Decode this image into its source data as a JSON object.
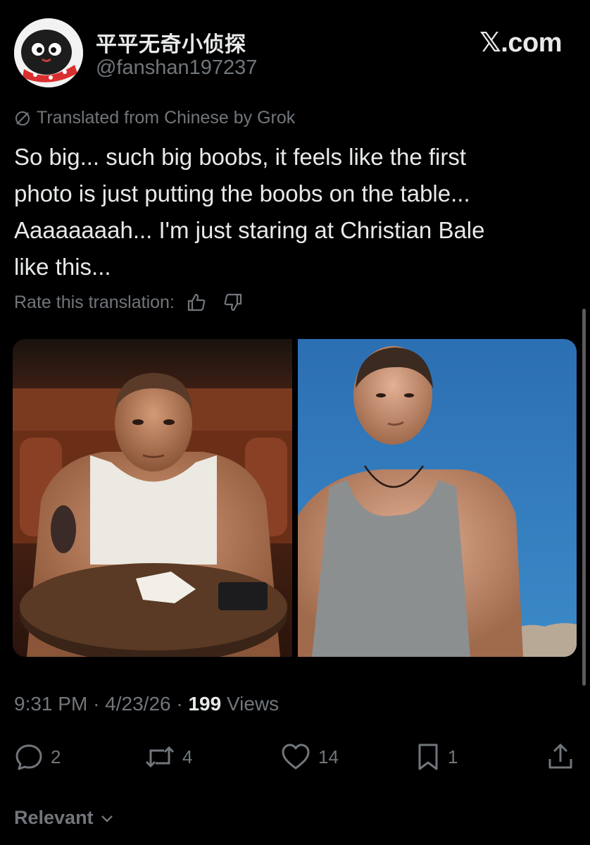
{
  "user": {
    "display_name": "平平无奇小侦探",
    "handle": "@fanshan197237",
    "avatar_icon": "cartoon-avatar-icon"
  },
  "brand": {
    "x": "𝕏",
    "suffix": ".com"
  },
  "translation": {
    "notice": "Translated from Chinese by Grok",
    "rate_label": "Rate this translation:"
  },
  "tweet": {
    "lines": [
      "So big... such big boobs, it feels like the first",
      "photo is just putting the boobs on the table...",
      "Aaaaaaaah... I'm just staring at Christian Bale",
      "like this..."
    ]
  },
  "meta": {
    "time": "9:31 PM",
    "sep1": "·",
    "date": "4/23/26",
    "sep2": "·",
    "views_count": "199",
    "views_label": "Views"
  },
  "actions": {
    "replies": "2",
    "reposts": "4",
    "likes": "14",
    "bookmarks": "1"
  },
  "sort": {
    "label": "Relevant"
  },
  "colors": {
    "background": "#000000",
    "text": "#e7e9ea",
    "muted": "#71767b"
  }
}
